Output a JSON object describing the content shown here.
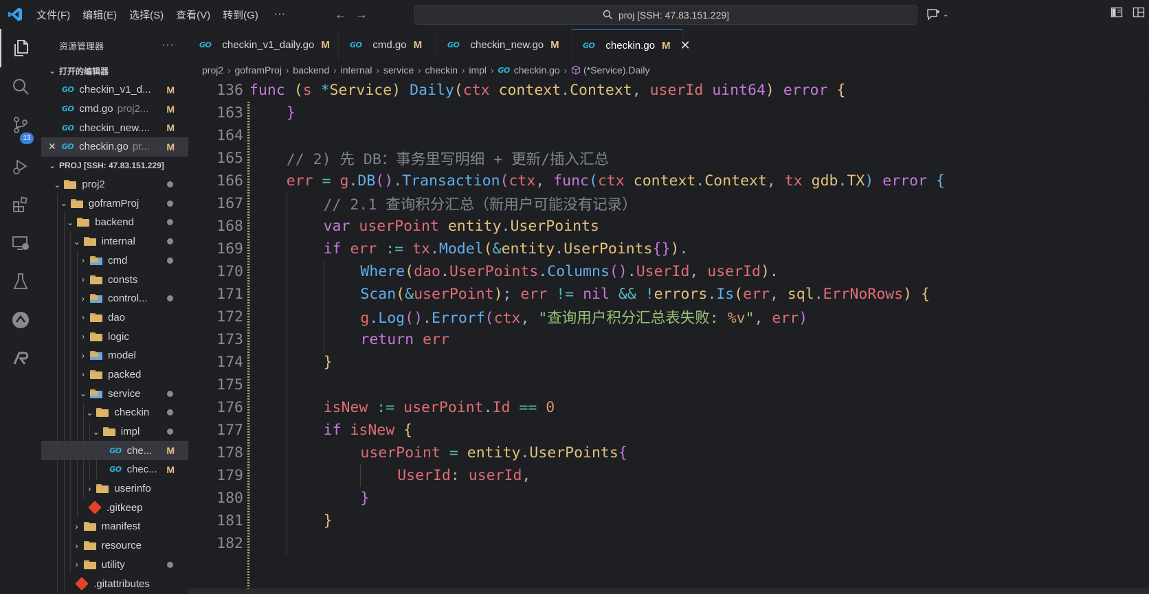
{
  "titlebar": {
    "menus": [
      "文件(F)",
      "编辑(E)",
      "选择(S)",
      "查看(V)",
      "转到(G)"
    ],
    "more": "···",
    "search": "proj [SSH: 47.83.151.229]"
  },
  "activity": {
    "scm_badge": "13"
  },
  "sidebar": {
    "title": "资源管理器",
    "more": "···",
    "open_editors_title": "打开的编辑器",
    "open_editors": [
      {
        "icon": "GO",
        "name": "checkin_v1_d...",
        "dim": "",
        "mod": "M",
        "close": ""
      },
      {
        "icon": "GO",
        "name": "cmd.go",
        "dim": "proj2...",
        "mod": "M",
        "close": ""
      },
      {
        "icon": "GO",
        "name": "checkin_new....",
        "dim": "",
        "mod": "M",
        "close": ""
      },
      {
        "icon": "GO",
        "name": "checkin.go",
        "dim": "pr...",
        "mod": "M",
        "close": "✕"
      }
    ],
    "workspace_title": "PROJ [SSH: 47.83.151.229]",
    "tree": [
      {
        "name": "proj2",
        "chev": "⌄",
        "kind": "folder",
        "status": "dot"
      },
      {
        "name": "goframProj",
        "chev": "⌄",
        "kind": "folder",
        "status": "dot"
      },
      {
        "name": "backend",
        "chev": "⌄",
        "kind": "folder",
        "status": "dot"
      },
      {
        "name": "internal",
        "chev": "⌄",
        "kind": "folder",
        "status": "dot"
      },
      {
        "name": "cmd",
        "chev": "›",
        "kind": "folder-special",
        "status": "dot"
      },
      {
        "name": "consts",
        "chev": "›",
        "kind": "folder",
        "status": ""
      },
      {
        "name": "control...",
        "chev": "›",
        "kind": "folder-special",
        "status": "dot"
      },
      {
        "name": "dao",
        "chev": "›",
        "kind": "folder",
        "status": ""
      },
      {
        "name": "logic",
        "chev": "›",
        "kind": "folder",
        "status": ""
      },
      {
        "name": "model",
        "chev": "›",
        "kind": "folder-special",
        "status": ""
      },
      {
        "name": "packed",
        "chev": "›",
        "kind": "folder",
        "status": ""
      },
      {
        "name": "service",
        "chev": "⌄",
        "kind": "folder-special",
        "status": "dot"
      },
      {
        "name": "checkin",
        "chev": "⌄",
        "kind": "folder",
        "status": "dot"
      },
      {
        "name": "impl",
        "chev": "⌄",
        "kind": "folder",
        "status": "dot"
      },
      {
        "name": "che...",
        "chev": "",
        "kind": "go",
        "status": "M"
      },
      {
        "name": "chec...",
        "chev": "",
        "kind": "go",
        "status": "M"
      },
      {
        "name": "userinfo",
        "chev": "›",
        "kind": "folder",
        "status": ""
      },
      {
        "name": ".gitkeep",
        "chev": "",
        "kind": "git",
        "status": ""
      },
      {
        "name": "manifest",
        "chev": "›",
        "kind": "folder",
        "status": ""
      },
      {
        "name": "resource",
        "chev": "›",
        "kind": "folder",
        "status": ""
      },
      {
        "name": "utility",
        "chev": "›",
        "kind": "folder",
        "status": "dot"
      },
      {
        "name": ".gitattributes",
        "chev": "",
        "kind": "git",
        "status": ""
      }
    ]
  },
  "tabs": [
    {
      "icon": "GO",
      "label": "checkin_v1_daily.go",
      "mod": "M"
    },
    {
      "icon": "GO",
      "label": "cmd.go",
      "mod": "M"
    },
    {
      "icon": "GO",
      "label": "checkin_new.go",
      "mod": "M"
    },
    {
      "icon": "GO",
      "label": "checkin.go",
      "mod": "M",
      "close": "✕"
    }
  ],
  "breadcrumbs": [
    "proj2",
    "goframProj",
    "backend",
    "internal",
    "service",
    "checkin",
    "impl",
    "checkin.go",
    "(*Service).Daily"
  ],
  "editor": {
    "lines": [
      {
        "n": "136",
        "indent": 0
      },
      {
        "n": "163",
        "indent": 1
      },
      {
        "n": "164",
        "indent": 0
      },
      {
        "n": "165",
        "indent": 1
      },
      {
        "n": "166",
        "indent": 1
      },
      {
        "n": "167",
        "indent": 2
      },
      {
        "n": "168",
        "indent": 2
      },
      {
        "n": "169",
        "indent": 2
      },
      {
        "n": "170",
        "indent": 3
      },
      {
        "n": "171",
        "indent": 3
      },
      {
        "n": "172",
        "indent": 3
      },
      {
        "n": "173",
        "indent": 3
      },
      {
        "n": "174",
        "indent": 2
      },
      {
        "n": "175",
        "indent": 0
      },
      {
        "n": "176",
        "indent": 2
      },
      {
        "n": "177",
        "indent": 2
      },
      {
        "n": "178",
        "indent": 3
      },
      {
        "n": "179",
        "indent": 4
      },
      {
        "n": "180",
        "indent": 3
      },
      {
        "n": "181",
        "indent": 2
      },
      {
        "n": "182",
        "indent": 0
      }
    ],
    "tokens": [
      [
        [
          "kw",
          "func"
        ],
        [
          "pl",
          " "
        ],
        [
          "b1",
          "("
        ],
        [
          "id",
          "s"
        ],
        [
          "pl",
          " "
        ],
        [
          "op",
          "*"
        ],
        [
          "ty",
          "Service"
        ],
        [
          "b1",
          ")"
        ],
        [
          "pl",
          " "
        ],
        [
          "fn",
          "Daily"
        ],
        [
          "b1",
          "("
        ],
        [
          "id",
          "ctx"
        ],
        [
          "pl",
          " "
        ],
        [
          "ty",
          "context"
        ],
        [
          "pl",
          "."
        ],
        [
          "ty",
          "Context"
        ],
        [
          "pl",
          ", "
        ],
        [
          "id",
          "userId"
        ],
        [
          "pl",
          " "
        ],
        [
          "kw",
          "uint64"
        ],
        [
          "b1",
          ")"
        ],
        [
          "pl",
          " "
        ],
        [
          "kw",
          "error"
        ],
        [
          "pl",
          " "
        ],
        [
          "b1",
          "{"
        ]
      ],
      [
        [
          "b2",
          "}"
        ]
      ],
      [],
      [
        [
          "cm",
          "// 2) 先 DB：事务里写明细 + 更新/插入汇总"
        ]
      ],
      [
        [
          "id",
          "err"
        ],
        [
          "pl",
          " "
        ],
        [
          "op",
          "="
        ],
        [
          "pl",
          " "
        ],
        [
          "id",
          "g"
        ],
        [
          "pl",
          "."
        ],
        [
          "fn",
          "DB"
        ],
        [
          "b2",
          "()"
        ],
        [
          "pl",
          "."
        ],
        [
          "fn",
          "Transaction"
        ],
        [
          "b2",
          "("
        ],
        [
          "id",
          "ctx"
        ],
        [
          "pl",
          ", "
        ],
        [
          "kw",
          "func"
        ],
        [
          "b3",
          "("
        ],
        [
          "id",
          "ctx"
        ],
        [
          "pl",
          " "
        ],
        [
          "ty",
          "context"
        ],
        [
          "pl",
          "."
        ],
        [
          "ty",
          "Context"
        ],
        [
          "pl",
          ", "
        ],
        [
          "id",
          "tx"
        ],
        [
          "pl",
          " "
        ],
        [
          "ty",
          "gdb"
        ],
        [
          "pl",
          "."
        ],
        [
          "ty",
          "TX"
        ],
        [
          "b3",
          ")"
        ],
        [
          "pl",
          " "
        ],
        [
          "kw",
          "error"
        ],
        [
          "pl",
          " "
        ],
        [
          "b3",
          "{"
        ]
      ],
      [
        [
          "cm",
          "// 2.1 查询积分汇总（新用户可能没有记录）"
        ]
      ],
      [
        [
          "kw",
          "var"
        ],
        [
          "pl",
          " "
        ],
        [
          "id",
          "userPoint"
        ],
        [
          "pl",
          " "
        ],
        [
          "ty",
          "entity"
        ],
        [
          "pl",
          "."
        ],
        [
          "ty",
          "UserPoints"
        ]
      ],
      [
        [
          "kw",
          "if"
        ],
        [
          "pl",
          " "
        ],
        [
          "id",
          "err"
        ],
        [
          "pl",
          " "
        ],
        [
          "op",
          ":="
        ],
        [
          "pl",
          " "
        ],
        [
          "id",
          "tx"
        ],
        [
          "pl",
          "."
        ],
        [
          "fn",
          "Model"
        ],
        [
          "b1",
          "("
        ],
        [
          "op",
          "&"
        ],
        [
          "ty",
          "entity"
        ],
        [
          "pl",
          "."
        ],
        [
          "ty",
          "UserPoints"
        ],
        [
          "b2",
          "{}"
        ],
        [
          "b1",
          ")"
        ],
        [
          "pl",
          "."
        ]
      ],
      [
        [
          "fn",
          "Where"
        ],
        [
          "b1",
          "("
        ],
        [
          "id",
          "dao"
        ],
        [
          "pl",
          "."
        ],
        [
          "id",
          "UserPoints"
        ],
        [
          "pl",
          "."
        ],
        [
          "fn",
          "Columns"
        ],
        [
          "b2",
          "()"
        ],
        [
          "pl",
          "."
        ],
        [
          "id",
          "UserId"
        ],
        [
          "pl",
          ", "
        ],
        [
          "id",
          "userId"
        ],
        [
          "b1",
          ")"
        ],
        [
          "pl",
          "."
        ]
      ],
      [
        [
          "fn",
          "Scan"
        ],
        [
          "b1",
          "("
        ],
        [
          "op",
          "&"
        ],
        [
          "id",
          "userPoint"
        ],
        [
          "b1",
          ")"
        ],
        [
          "pl",
          "; "
        ],
        [
          "id",
          "err"
        ],
        [
          "pl",
          " "
        ],
        [
          "op",
          "!="
        ],
        [
          "pl",
          " "
        ],
        [
          "kw",
          "nil"
        ],
        [
          "pl",
          " "
        ],
        [
          "op",
          "&&"
        ],
        [
          "pl",
          " "
        ],
        [
          "op",
          "!"
        ],
        [
          "ty",
          "errors"
        ],
        [
          "pl",
          "."
        ],
        [
          "fn",
          "Is"
        ],
        [
          "b1",
          "("
        ],
        [
          "id",
          "err"
        ],
        [
          "pl",
          ", "
        ],
        [
          "ty",
          "sql"
        ],
        [
          "pl",
          "."
        ],
        [
          "id",
          "ErrNoRows"
        ],
        [
          "b1",
          ")"
        ],
        [
          "pl",
          " "
        ],
        [
          "b1",
          "{"
        ]
      ],
      [
        [
          "id",
          "g"
        ],
        [
          "pl",
          "."
        ],
        [
          "fn",
          "Log"
        ],
        [
          "b2",
          "()"
        ],
        [
          "pl",
          "."
        ],
        [
          "fn",
          "Errorf"
        ],
        [
          "b2",
          "("
        ],
        [
          "id",
          "ctx"
        ],
        [
          "pl",
          ", "
        ],
        [
          "str",
          "\"查询用户积分汇总表失败: "
        ],
        [
          "num",
          "%v"
        ],
        [
          "str",
          "\""
        ],
        [
          "pl",
          ", "
        ],
        [
          "id",
          "err"
        ],
        [
          "b2",
          ")"
        ]
      ],
      [
        [
          "kw",
          "return"
        ],
        [
          "pl",
          " "
        ],
        [
          "id",
          "err"
        ]
      ],
      [
        [
          "b1",
          "}"
        ]
      ],
      [],
      [
        [
          "id",
          "isNew"
        ],
        [
          "pl",
          " "
        ],
        [
          "op",
          ":="
        ],
        [
          "pl",
          " "
        ],
        [
          "id",
          "userPoint"
        ],
        [
          "pl",
          "."
        ],
        [
          "id",
          "Id"
        ],
        [
          "pl",
          " "
        ],
        [
          "op",
          "=="
        ],
        [
          "pl",
          " "
        ],
        [
          "num",
          "0"
        ]
      ],
      [
        [
          "kw",
          "if"
        ],
        [
          "pl",
          " "
        ],
        [
          "id",
          "isNew"
        ],
        [
          "pl",
          " "
        ],
        [
          "b1",
          "{"
        ]
      ],
      [
        [
          "id",
          "userPoint"
        ],
        [
          "pl",
          " "
        ],
        [
          "op",
          "="
        ],
        [
          "pl",
          " "
        ],
        [
          "ty",
          "entity"
        ],
        [
          "pl",
          "."
        ],
        [
          "ty",
          "UserPoints"
        ],
        [
          "b2",
          "{"
        ]
      ],
      [
        [
          "id",
          "UserId"
        ],
        [
          "pl",
          ": "
        ],
        [
          "id",
          "userId"
        ],
        [
          "pl",
          ","
        ]
      ],
      [
        [
          "b2",
          "}"
        ]
      ],
      [
        [
          "b1",
          "}"
        ]
      ],
      []
    ]
  }
}
